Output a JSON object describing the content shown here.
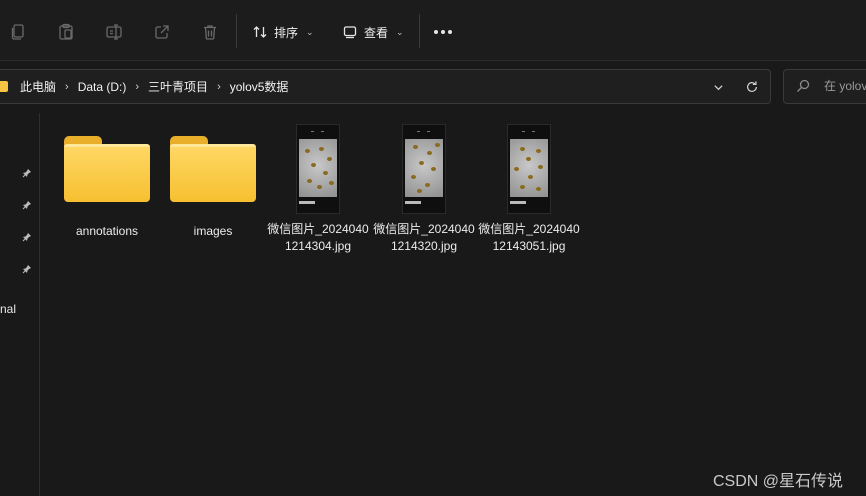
{
  "toolbar": {
    "sort_label": "排序",
    "view_label": "查看"
  },
  "address": {
    "crumbs": [
      "此电脑",
      "Data (D:)",
      "三叶青项目",
      "yolov5数据"
    ]
  },
  "search": {
    "placeholder": "在 yolov"
  },
  "navpane": {
    "partial_label": "nal"
  },
  "files": [
    {
      "name": "annotations",
      "kind": "folder"
    },
    {
      "name": "images",
      "kind": "folder"
    },
    {
      "name": "微信图片_20240401214304.jpg",
      "kind": "image"
    },
    {
      "name": "微信图片_20240401214320.jpg",
      "kind": "image"
    },
    {
      "name": "微信图片_202404012143051.jpg",
      "kind": "image"
    }
  ],
  "watermark": "CSDN @星石传说",
  "colors": {
    "background": "#191919",
    "folder_yellow": "#f6c343"
  },
  "icons": [
    "copy-icon",
    "paste-icon",
    "rename-icon",
    "share-icon",
    "delete-icon",
    "sort-icon",
    "view-icon",
    "more-icon",
    "refresh-icon",
    "search-icon",
    "pin-icon"
  ]
}
